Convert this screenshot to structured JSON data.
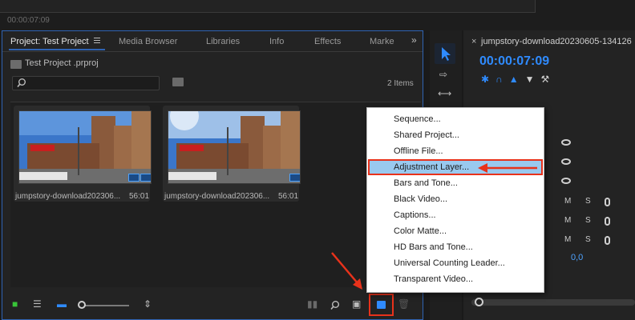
{
  "top": {
    "timecode": "00:00:07:09"
  },
  "project_panel": {
    "tabs": [
      {
        "label": "Project: Test Project",
        "active": true
      },
      {
        "label": "Media Browser"
      },
      {
        "label": "Libraries"
      },
      {
        "label": "Info"
      },
      {
        "label": "Effects"
      },
      {
        "label": "Marke"
      }
    ],
    "project_file": "Test Project .prproj",
    "search": {
      "placeholder": "",
      "value": ""
    },
    "items_count": "2 Items",
    "clips": [
      {
        "name": "jumpstory-download202306...",
        "duration": "56:01"
      },
      {
        "name": "jumpstory-download202306...",
        "duration": "56:01"
      }
    ]
  },
  "new_item_menu": {
    "items": [
      "Sequence...",
      "Shared Project...",
      "Offline File...",
      "Adjustment Layer...",
      "Bars and Tone...",
      "Black Video...",
      "Captions...",
      "Color Matte...",
      "HD Bars and Tone...",
      "Universal Counting Leader...",
      "Transparent Video..."
    ],
    "highlighted_index": 3
  },
  "timeline": {
    "close": "×",
    "title": "jumpstory-download20230605-134126",
    "timecode": "00:00:07:09",
    "audio_track_labels": [
      "M",
      "S"
    ],
    "volume": "0,0"
  },
  "colors": {
    "accent_blue": "#2f8bff",
    "annotation_red": "#e8321b",
    "menu_highlight": "#99c9ef"
  }
}
